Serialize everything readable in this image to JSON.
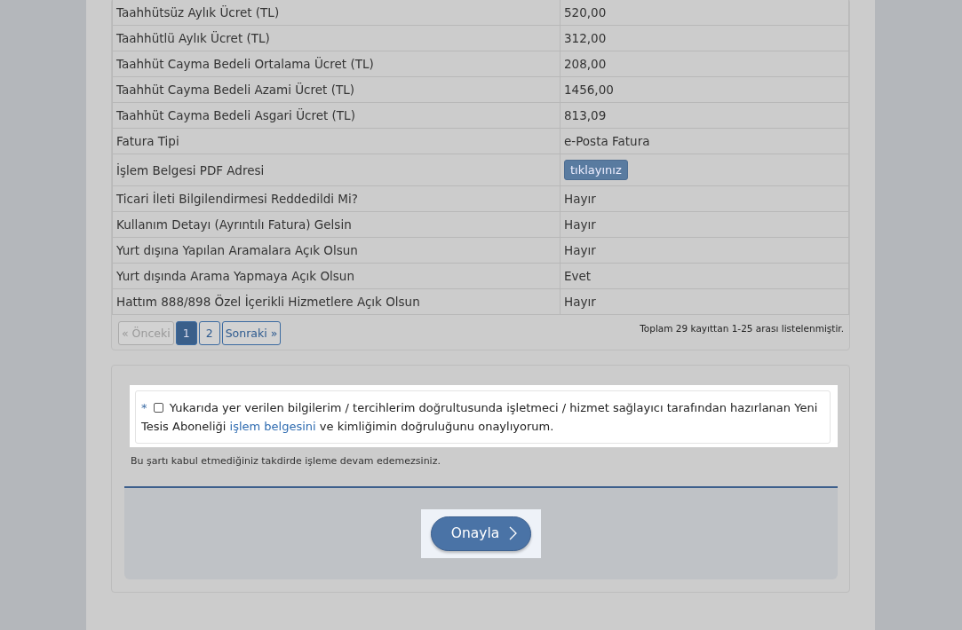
{
  "details_table": {
    "rows": [
      {
        "label": "Taahhütsüz Aylık Ücret (TL)",
        "value": "520,00",
        "kind": "text"
      },
      {
        "label": "Taahhütlü Aylık Ücret (TL)",
        "value": "312,00",
        "kind": "text"
      },
      {
        "label": "Taahhüt Cayma Bedeli Ortalama Ücret (TL)",
        "value": "208,00",
        "kind": "text"
      },
      {
        "label": "Taahhüt Cayma Bedeli Azami Ücret (TL)",
        "value": "1456,00",
        "kind": "text"
      },
      {
        "label": "Taahhüt Cayma Bedeli Asgari Ücret (TL)",
        "value": "813,09",
        "kind": "text"
      },
      {
        "label": "Fatura Tipi",
        "value": "e-Posta Fatura",
        "kind": "text"
      },
      {
        "label": "İşlem Belgesi PDF Adresi",
        "value": "tıklayınız",
        "kind": "button"
      },
      {
        "label": "Ticari İleti Bilgilendirmesi Reddedildi Mi?",
        "value": "Hayır",
        "kind": "text"
      },
      {
        "label": "Kullanım Detayı (Ayrıntılı Fatura) Gelsin",
        "value": "Hayır",
        "kind": "text"
      },
      {
        "label": "Yurt dışına Yapılan Aramalara Açık Olsun",
        "value": "Hayır",
        "kind": "text"
      },
      {
        "label": "Yurt dışında Arama Yapmaya Açık Olsun",
        "value": "Evet",
        "kind": "text"
      },
      {
        "label": "Hattım 888/898 Özel İçerikli Hizmetlere Açık Olsun",
        "value": "Hayır",
        "kind": "text"
      }
    ],
    "pagination": [
      {
        "label": "« Önceki",
        "selected": false,
        "disabled": true
      },
      {
        "label": "1",
        "selected": true,
        "disabled": false
      },
      {
        "label": "2",
        "selected": false,
        "disabled": false
      },
      {
        "label": "Sonraki »",
        "selected": false,
        "disabled": false
      }
    ],
    "summary": "Toplam 29 kayıttan 1-25 arası listelenmiştir."
  },
  "consent": {
    "required_mark": "*",
    "checked": false,
    "text_before": "Yukarıda yer verilen bilgilerim / tercihlerim doğrultusunda işletmeci / hizmet sağlayıcı tarafından hazırlanan Yeni Tesis Aboneliği",
    "link": "işlem belgesini",
    "text_after": "ve kimliğimin doğruluğunu onaylıyorum.",
    "note": "Bu şartı kabul etmediğiniz takdirde işleme devam edemezsiniz."
  },
  "confirm_button": {
    "label": "Onayla"
  }
}
